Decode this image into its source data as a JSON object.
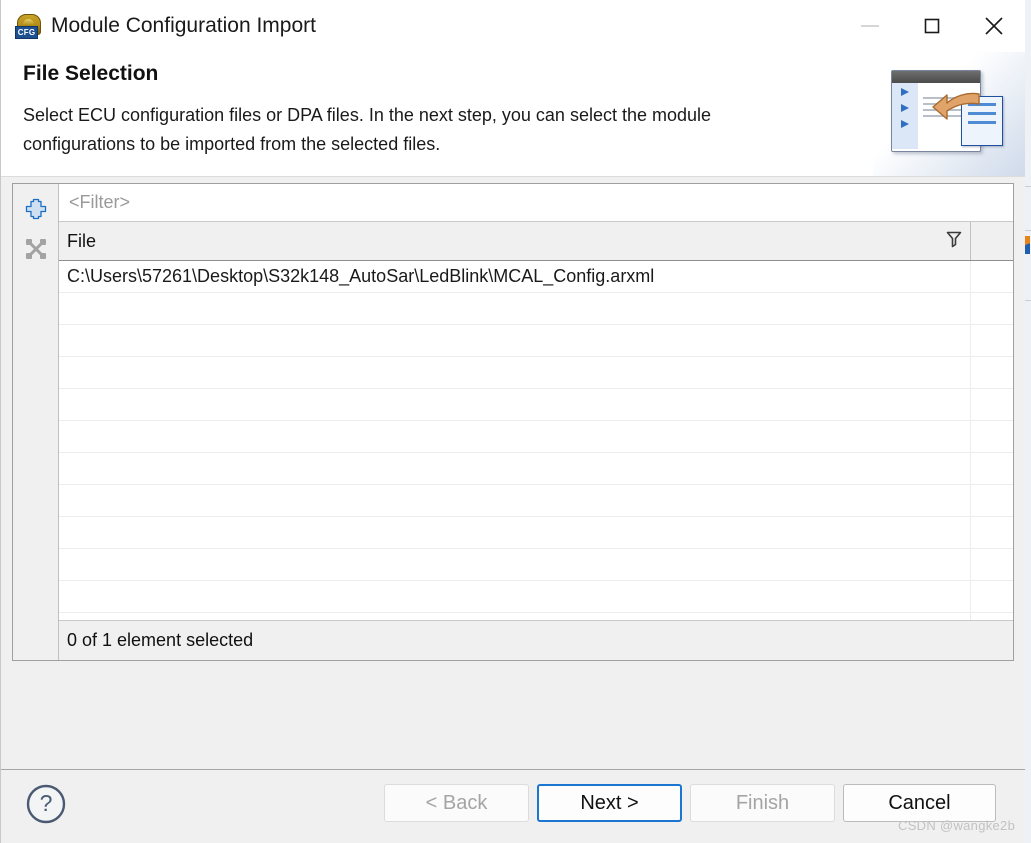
{
  "window": {
    "title": "Module Configuration Import",
    "icon": "cfg-module-icon",
    "icon_badge": "CFG",
    "controls": {
      "minimize": "minimize-icon",
      "maximize": "maximize-icon",
      "close": "close-icon"
    }
  },
  "header": {
    "title": "File Selection",
    "description": "Select ECU configuration files or DPA files. In the next step, you can select the module configurations to be imported from the selected files.",
    "banner_icon": "import-wizard-banner"
  },
  "toolbar": {
    "add_label": "add-icon",
    "remove_label": "remove-icon"
  },
  "filter": {
    "value": "",
    "placeholder": "<Filter>"
  },
  "table": {
    "columns": [
      "File"
    ],
    "filter_icon": "funnel-icon",
    "rows": [
      {
        "file": "C:\\Users\\57261\\Desktop\\S32k148_AutoSar\\LedBlink\\MCAL_Config.arxml"
      },
      {
        "file": ""
      },
      {
        "file": ""
      },
      {
        "file": ""
      },
      {
        "file": ""
      },
      {
        "file": ""
      },
      {
        "file": ""
      },
      {
        "file": ""
      },
      {
        "file": ""
      },
      {
        "file": ""
      },
      {
        "file": ""
      },
      {
        "file": ""
      }
    ],
    "status": "0 of 1 element selected"
  },
  "buttons": {
    "help": "help-icon",
    "back": "< Back",
    "next": "Next >",
    "finish": "Finish",
    "cancel": "Cancel"
  },
  "watermark": "CSDN @wangke2b",
  "colors": {
    "accent": "#1b76d2",
    "dialog_bg": "#f0f0f0",
    "header_bg": "#ffffff",
    "disabled_text": "#a4a4a4"
  }
}
